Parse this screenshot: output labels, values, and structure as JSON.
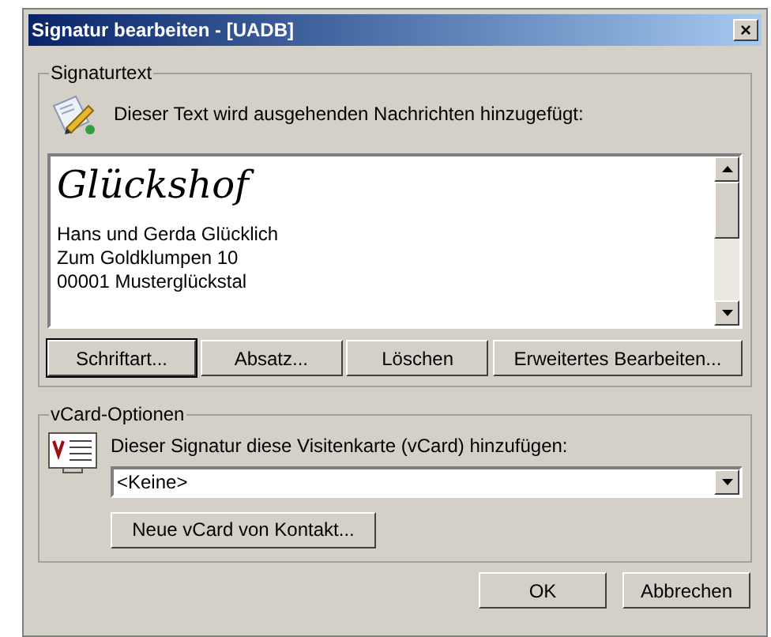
{
  "window": {
    "title": "Signatur bearbeiten - [UADB]",
    "close": "×"
  },
  "signature_group": {
    "legend": "Signaturtext",
    "hint": "Dieser Text wird ausgehenden Nachrichten hinzugefügt:",
    "lines": [
      {
        "kind": "script",
        "text": "Glückshof"
      },
      {
        "kind": "plain",
        "text": "Hans und Gerda Glücklich"
      },
      {
        "kind": "plain",
        "text": "Zum Goldklumpen 10"
      },
      {
        "kind": "plain",
        "text": "00001 Musterglückstal"
      }
    ],
    "buttons": [
      {
        "label": "Schriftart...",
        "focused": true
      },
      {
        "label": "Absatz...",
        "focused": false
      },
      {
        "label": "Löschen",
        "focused": false
      },
      {
        "label": "Erweitertes Bearbeiten...",
        "focused": false
      }
    ]
  },
  "vcard_group": {
    "legend": "vCard-Optionen",
    "hint": "Dieser Signatur diese Visitenkarte (vCard) hinzufügen:",
    "dropdown": {
      "value": "<Keine>"
    },
    "button": "Neue vCard von Kontakt..."
  },
  "buttons": [
    "OK",
    "Abbrechen"
  ]
}
